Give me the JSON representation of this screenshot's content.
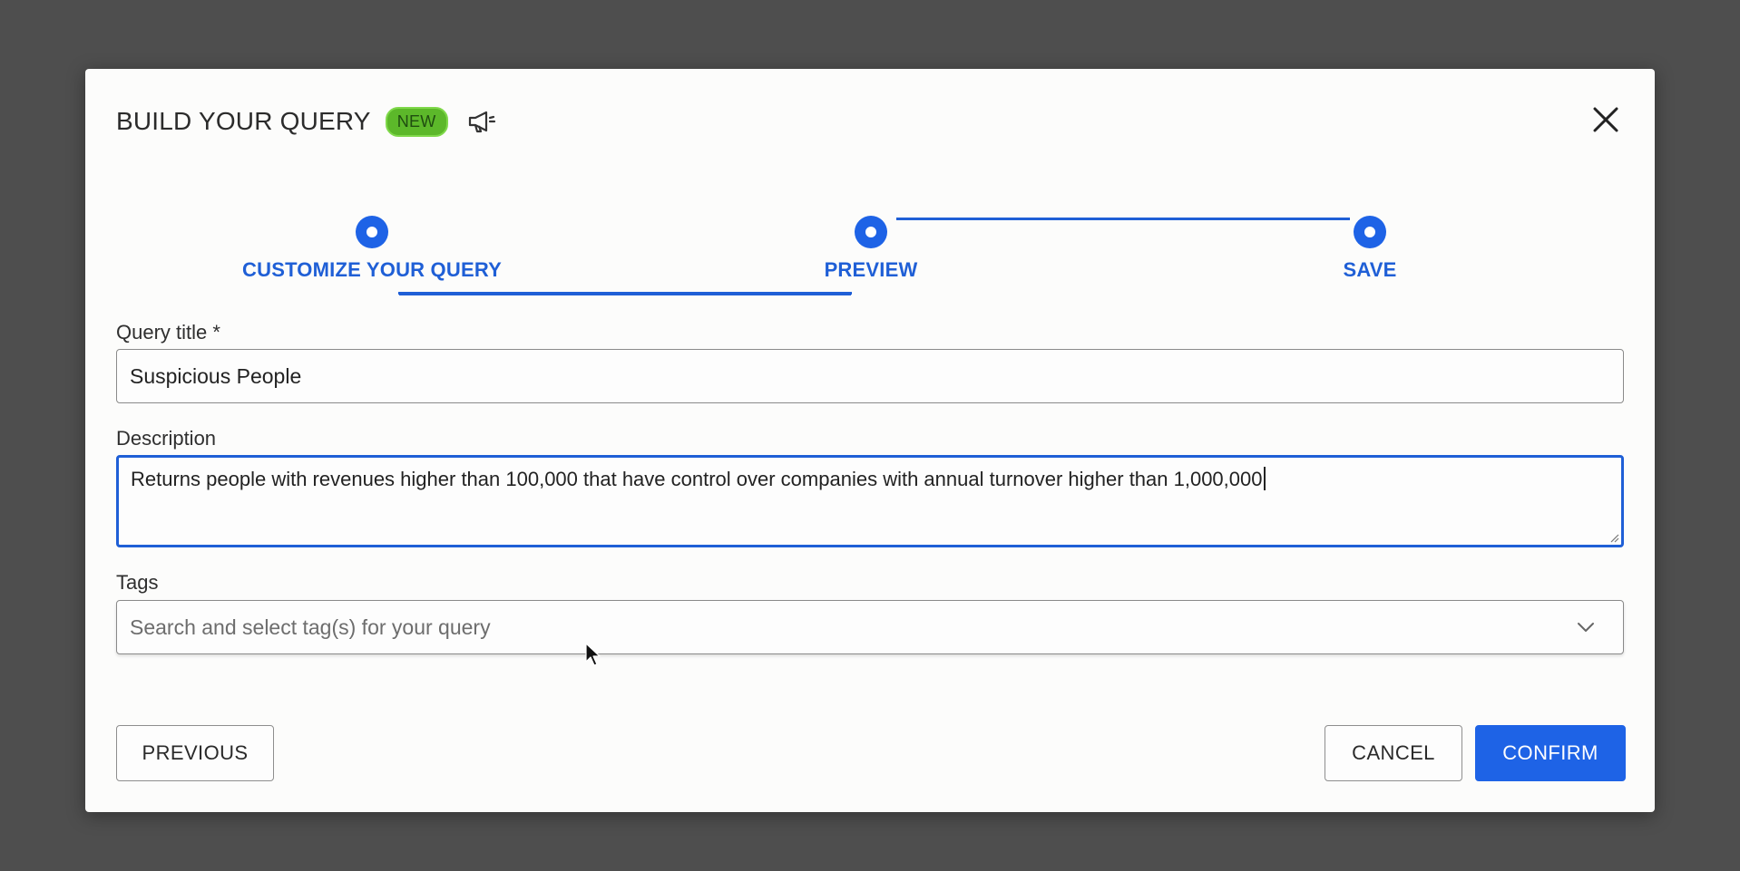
{
  "dialog": {
    "title": "BUILD YOUR QUERY",
    "badge": "NEW",
    "megaphone_icon": "megaphone-icon",
    "close_icon": "close-icon"
  },
  "stepper": {
    "steps": [
      {
        "label": "CUSTOMIZE YOUR QUERY"
      },
      {
        "label": "PREVIEW"
      },
      {
        "label": "SAVE"
      }
    ],
    "accent_color": "#1e63e6"
  },
  "form": {
    "query_title": {
      "label": "Query title *",
      "value": "Suspicious People"
    },
    "description": {
      "label": "Description",
      "value": "Returns people with revenues higher than 100,000 that have control over companies with annual turnover higher than 1,000,000"
    },
    "tags": {
      "label": "Tags",
      "placeholder": "Search and select tag(s) for your query"
    }
  },
  "footer": {
    "previous_label": "PREVIOUS",
    "cancel_label": "CANCEL",
    "confirm_label": "CONFIRM"
  },
  "colors": {
    "badge_green": "#5cb82a",
    "primary_blue": "#1e63e6"
  }
}
